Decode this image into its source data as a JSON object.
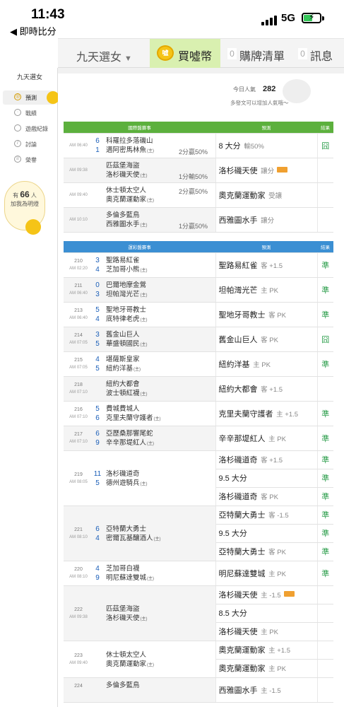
{
  "status": {
    "time": "11:43",
    "back_label": "◀ 即時比分",
    "network": "5G"
  },
  "header": {
    "team": "九天選女",
    "buy_label": "買噓幣",
    "coin_text": "噓",
    "cart_count": "0",
    "cart_label": "購牌清單",
    "msg_count": "0",
    "msg_label": "訊息"
  },
  "sidebar": {
    "brand": "九天選女",
    "items": [
      {
        "label": "預測",
        "active": true
      },
      {
        "label": "戰績"
      },
      {
        "label": "遊戲紀錄"
      },
      {
        "label": "討論"
      },
      {
        "label": "榮譽"
      }
    ],
    "fans_prefix": "有",
    "fans_count": "66",
    "fans_suffix": "人",
    "fans_line2": "加我為明燈"
  },
  "popularity": {
    "label": "今日人氣",
    "value": "282",
    "hint": "多發文可以增加人氣哦～"
  },
  "intl": {
    "headers": {
      "game": "國際盤賽事",
      "pred": "預測",
      "res": "結果"
    },
    "rows": [
      {
        "time": "AM 06:40",
        "s1": "6",
        "s2": "1",
        "t1": "科羅拉多落磯山",
        "t2": "邁阿密馬林魚",
        "t2h": "(主)",
        "odds": "",
        "odds2": "2分贏50%",
        "pred": "8 大分",
        "pcls": "輸50%",
        "res": "囧"
      },
      {
        "time": "AM 09:38",
        "s1": "",
        "s2": "",
        "t1": "匹茲堡海盜",
        "t2": "洛杉磯天使",
        "t2h": "(主)",
        "odds": "",
        "odds2": "1分輸50%",
        "pred": "洛杉磯天使",
        "pcls": "讓分",
        "hot": true,
        "res": ""
      },
      {
        "time": "AM 09:40",
        "s1": "",
        "s2": "",
        "t1": "休士頓太空人",
        "t2": "奧克蘭運動家",
        "t2h": "(主)",
        "odds": "2分贏50%",
        "odds2": "",
        "pred": "奧克蘭運動家",
        "pcls": "受讓",
        "res": ""
      },
      {
        "time": "AM 10:10",
        "s1": "",
        "s2": "",
        "t1": "多倫多藍鳥",
        "t2": "西雅圖水手",
        "t2h": "(主)",
        "odds": "",
        "odds2": "1分贏50%",
        "pred": "西雅圖水手",
        "pcls": "讓分",
        "res": ""
      }
    ]
  },
  "lottery": {
    "headers": {
      "game": "運彩盤賽事",
      "pred": "預測",
      "res": "結果"
    },
    "games": [
      {
        "no": "210",
        "time": "AM 02:20",
        "s1": "3",
        "s2": "4",
        "t1": "聖路易紅雀",
        "t2": "芝加哥小熊",
        "t2h": "(主)",
        "preds": [
          {
            "text": "聖路易紅雀",
            "cls": "客 +1.5",
            "res": "準"
          }
        ]
      },
      {
        "no": "211",
        "time": "AM 06:40",
        "s1": "0",
        "s2": "3",
        "t1": "巴爾地摩金鶯",
        "t2": "坦帕灣光芒",
        "t2h": "(主)",
        "preds": [
          {
            "text": "坦帕灣光芒",
            "cls": "主 PK",
            "res": "準"
          }
        ]
      },
      {
        "no": "213",
        "time": "AM 06:40",
        "s1": "5",
        "s2": "4",
        "t1": "聖地牙哥教士",
        "t2": "底特律老虎",
        "t2h": "(主)",
        "preds": [
          {
            "text": "聖地牙哥教士",
            "cls": "客 PK",
            "res": "準"
          }
        ]
      },
      {
        "no": "214",
        "time": "AM 07:05",
        "s1": "3",
        "s2": "5",
        "t1": "舊金山巨人",
        "t2": "華盛頓國民",
        "t2h": "(主)",
        "preds": [
          {
            "text": "舊金山巨人",
            "cls": "客 PK",
            "res": "囧"
          }
        ]
      },
      {
        "no": "215",
        "time": "AM 07:05",
        "s1": "4",
        "s2": "5",
        "t1": "堪薩斯皇家",
        "t2": "紐約洋基",
        "t2h": "(主)",
        "preds": [
          {
            "text": "紐約洋基",
            "cls": "主 PK",
            "res": "準"
          }
        ]
      },
      {
        "no": "218",
        "time": "AM 07:10",
        "s1": "",
        "s2": "",
        "t1": "紐約大都會",
        "t2": "波士頓紅襪",
        "t2h": "(主)",
        "preds": [
          {
            "text": "紐約大都會",
            "cls": "客 +1.5",
            "res": ""
          }
        ]
      },
      {
        "no": "216",
        "time": "AM 07:10",
        "s1": "5",
        "s2": "6",
        "t1": "費城費城人",
        "t2": "克里夫蘭守護者",
        "t2h": "(主)",
        "preds": [
          {
            "text": "克里夫蘭守護者",
            "cls": "主 +1.5",
            "res": "準"
          }
        ]
      },
      {
        "no": "217",
        "time": "AM 07:10",
        "s1": "6",
        "s2": "9",
        "t1": "亞歷桑那響尾蛇",
        "t2": "辛辛那堤紅人",
        "t2h": "(主)",
        "preds": [
          {
            "text": "辛辛那堤紅人",
            "cls": "主 PK",
            "res": "準"
          }
        ]
      },
      {
        "no": "219",
        "time": "AM 08:05",
        "s1": "11",
        "s2": "5",
        "t1": "洛杉磯道奇",
        "t2": "德州遊騎兵",
        "t2h": "(主)",
        "preds": [
          {
            "text": "洛杉磯道奇",
            "cls": "客 +1.5",
            "res": "準"
          },
          {
            "text": "9.5 大分",
            "cls": "",
            "res": "準"
          },
          {
            "text": "洛杉磯道奇",
            "cls": "客 PK",
            "res": "準"
          }
        ]
      },
      {
        "no": "221",
        "time": "AM 08:10",
        "s1": "6",
        "s2": "4",
        "t1": "亞特蘭大勇士",
        "t2": "密爾瓦基釀酒人",
        "t2h": "(主)",
        "preds": [
          {
            "text": "亞特蘭大勇士",
            "cls": "客 -1.5",
            "res": "準"
          },
          {
            "text": "9.5 大分",
            "cls": "",
            "res": "準"
          },
          {
            "text": "亞特蘭大勇士",
            "cls": "客 PK",
            "res": "準"
          }
        ]
      },
      {
        "no": "220",
        "time": "AM 08:10",
        "s1": "4",
        "s2": "9",
        "t1": "芝加哥白襪",
        "t2": "明尼蘇達雙城",
        "t2h": "(主)",
        "preds": [
          {
            "text": "明尼蘇達雙城",
            "cls": "主 PK",
            "res": "準"
          }
        ]
      },
      {
        "no": "222",
        "time": "AM 09:38",
        "s1": "",
        "s2": "",
        "t1": "匹茲堡海盜",
        "t2": "洛杉磯天使",
        "t2h": "(主)",
        "preds": [
          {
            "text": "洛杉磯天使",
            "cls": "主 -1.5",
            "hot": true,
            "res": ""
          },
          {
            "text": "8.5 大分",
            "cls": "",
            "res": ""
          },
          {
            "text": "洛杉磯天使",
            "cls": "主 PK",
            "res": ""
          }
        ]
      },
      {
        "no": "223",
        "time": "AM 09:40",
        "s1": "",
        "s2": "",
        "t1": "休士頓太空人",
        "t2": "奧克蘭運動家",
        "t2h": "(主)",
        "preds": [
          {
            "text": "奧克蘭運動家",
            "cls": "主 +1.5",
            "res": ""
          },
          {
            "text": "奧克蘭運動家",
            "cls": "主 PK",
            "res": ""
          }
        ]
      },
      {
        "no": "224",
        "time": "",
        "s1": "",
        "s2": "",
        "t1": "多倫多藍鳥",
        "t2": "",
        "t2h": "",
        "preds": [
          {
            "text": "西雅圖水手",
            "cls": "主 -1.5",
            "res": ""
          }
        ]
      }
    ]
  }
}
